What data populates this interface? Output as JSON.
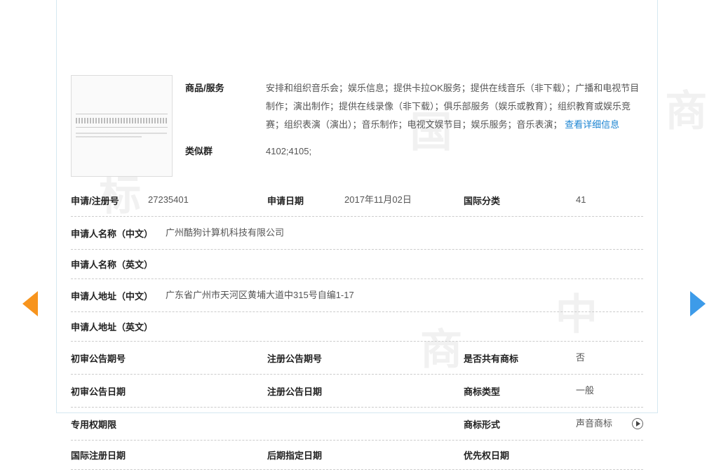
{
  "goods_services": {
    "label": "商品/服务",
    "text": "安排和组织音乐会；娱乐信息；提供卡拉OK服务；提供在线音乐（非下载）；广播和电视节目制作；演出制作；提供在线录像（非下载）；俱乐部服务（娱乐或教育）；组织教育或娱乐竞赛；组织表演（演出）；音乐制作；电视文娱节目；娱乐服务；音乐表演；",
    "more_link": "查看详细信息"
  },
  "similar_group": {
    "label": "类似群",
    "value": "4102;4105;"
  },
  "rows": [
    {
      "cols": [
        {
          "label": "申请/注册号",
          "value": "27235401",
          "w": "col1"
        },
        {
          "label": "申请日期",
          "value": "2017年11月02日",
          "w": "col2"
        },
        {
          "label": "国际分类",
          "value": "",
          "w": "col3"
        },
        {
          "label": "41",
          "value": "",
          "w": "col4",
          "label_is_value": true
        }
      ]
    },
    {
      "full": {
        "label": "申请人名称（中文）",
        "value": "广州酷狗计算机科技有限公司"
      }
    },
    {
      "full": {
        "label": "申请人名称（英文）",
        "value": ""
      }
    },
    {
      "full": {
        "label": "申请人地址（中文）",
        "value": "广东省广州市天河区黄埔大道中315号自编1-17"
      }
    },
    {
      "full": {
        "label": "申请人地址（英文）",
        "value": ""
      }
    },
    {
      "cols": [
        {
          "label": "初审公告期号",
          "value": "",
          "w": "col1"
        },
        {
          "label": "注册公告期号",
          "value": "",
          "w": "col2"
        },
        {
          "label": "是否共有商标",
          "value": "",
          "w": "col3"
        },
        {
          "label": "否",
          "value": "",
          "w": "col4",
          "label_is_value": true
        }
      ]
    },
    {
      "cols": [
        {
          "label": "初审公告日期",
          "value": "",
          "w": "col1"
        },
        {
          "label": "注册公告日期",
          "value": "",
          "w": "col2"
        },
        {
          "label": "商标类型",
          "value": "",
          "w": "col3"
        },
        {
          "label": "一般",
          "value": "",
          "w": "col4",
          "label_is_value": true
        }
      ]
    },
    {
      "cols": [
        {
          "label": "专用权期限",
          "value": "",
          "w": "col1"
        },
        {
          "label": "",
          "value": "",
          "w": "col2"
        },
        {
          "label": "商标形式",
          "value": "",
          "w": "col3"
        },
        {
          "label": "声音商标",
          "value": "",
          "w": "col4",
          "label_is_value": true,
          "play": true
        }
      ]
    },
    {
      "cols": [
        {
          "label": "国际注册日期",
          "value": "",
          "w": "col1"
        },
        {
          "label": "后期指定日期",
          "value": "",
          "w": "col2"
        },
        {
          "label": "优先权日期",
          "value": "",
          "w": "col3"
        },
        {
          "label": "",
          "value": "",
          "w": "col4"
        }
      ]
    }
  ]
}
